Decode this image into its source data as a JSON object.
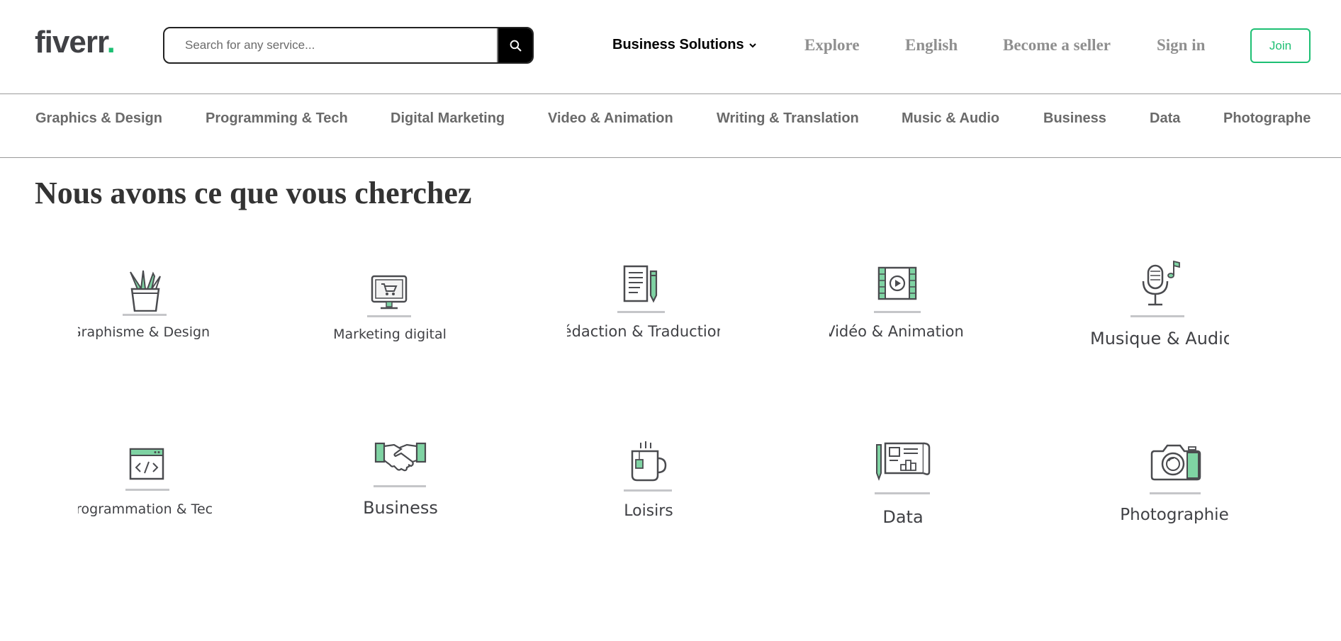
{
  "header": {
    "logo_text": "fiverr",
    "logo_dot": ".",
    "search_placeholder": "Search for any service...",
    "business_solutions": "Business Solutions",
    "explore": "Explore",
    "language": "English",
    "become_seller": "Become a seller",
    "sign_in": "Sign in",
    "join": "Join"
  },
  "categories": [
    "Graphics & Design",
    "Programming & Tech",
    "Digital Marketing",
    "Video & Animation",
    "Writing & Translation",
    "Music & Audio",
    "Business",
    "Data",
    "Photographe"
  ],
  "main": {
    "heading": "Nous avons ce que vous cherchez",
    "tiles": [
      {
        "label": "Graphisme & Design",
        "icon": "pencil-cup-icon"
      },
      {
        "label": "Marketing digital",
        "icon": "monitor-cart-icon"
      },
      {
        "label": "Rédaction & Traduction",
        "icon": "document-pen-icon"
      },
      {
        "label": "Vidéo & Animation",
        "icon": "film-play-icon"
      },
      {
        "label": "Musique & Audio",
        "icon": "microphone-note-icon"
      },
      {
        "label": "Programmation & Tech",
        "icon": "code-window-icon"
      },
      {
        "label": "Business",
        "icon": "handshake-icon"
      },
      {
        "label": "Loisirs",
        "icon": "tea-mug-icon"
      },
      {
        "label": "Data",
        "icon": "chart-board-icon"
      },
      {
        "label": "Photographie",
        "icon": "camera-icon"
      }
    ]
  },
  "colors": {
    "brand_green": "#1dbf73",
    "icon_green": "#7fd3a3",
    "icon_stroke": "#4a4b4f",
    "text_dark": "#404145"
  }
}
